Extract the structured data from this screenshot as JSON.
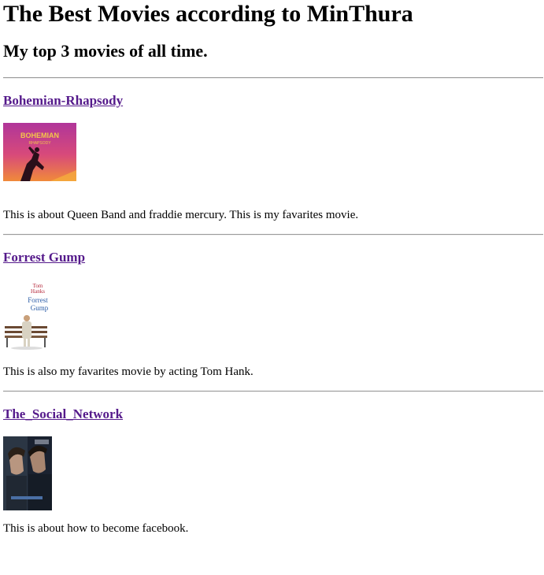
{
  "page": {
    "title": "The Best Movies according to MinThura",
    "subtitle": "My top 3 movies of all time."
  },
  "movies": [
    {
      "title": "Bohemian-Rhapsody",
      "poster_text": "BOHEMIAN",
      "poster_subtext": "RHAPSODY",
      "description": "This is about Queen Band and fraddie mercury. This is my favarites movie."
    },
    {
      "title": "Forrest Gump",
      "poster_line1": "Tom",
      "poster_line2": "Hanks",
      "poster_line3": "Forrest",
      "poster_line4": "Gump",
      "description": "This is also my favarites movie by acting Tom Hank."
    },
    {
      "title": "The_Social_Network",
      "description": "This is about how to become facebook."
    }
  ],
  "colors": {
    "link_visited": "#551a8b",
    "rule": "#9a9a9a"
  }
}
